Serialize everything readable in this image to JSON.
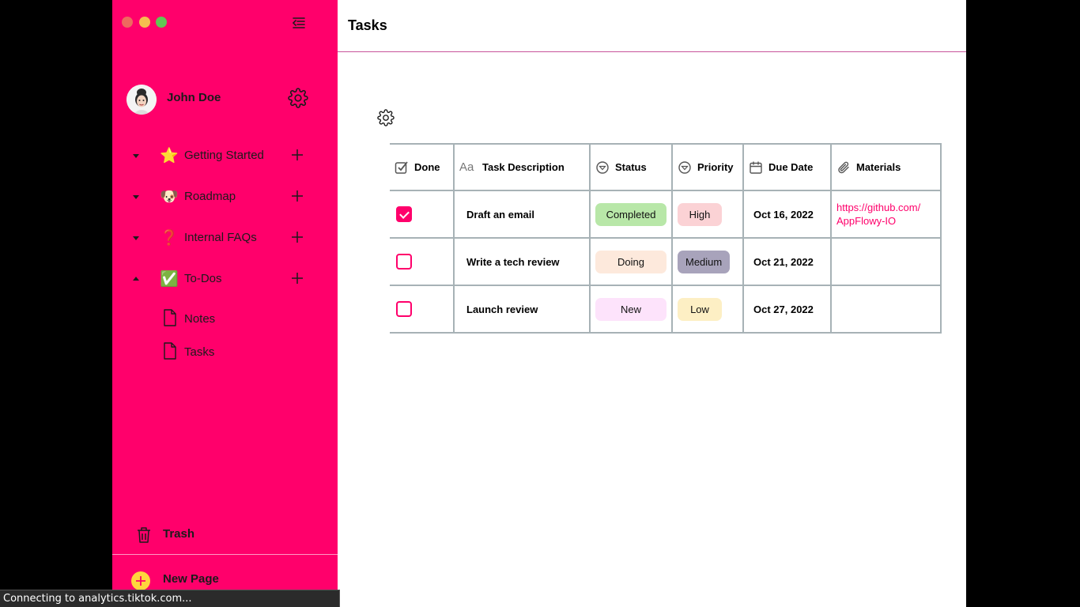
{
  "window": {
    "traffic_lights": [
      "#ee6a5f",
      "#f5bd4f",
      "#61c554"
    ]
  },
  "sidebar": {
    "bg_color": "#ff006b",
    "user": {
      "name": "John Doe"
    },
    "items": [
      {
        "label": "Getting Started",
        "emoji": "⭐",
        "expanded": false
      },
      {
        "label": "Roadmap",
        "emoji": "🐶",
        "expanded": false
      },
      {
        "label": "Internal FAQs",
        "emoji": "❓",
        "expanded": false
      },
      {
        "label": "To-Dos",
        "emoji": "✅",
        "expanded": true
      }
    ],
    "sub_items": [
      {
        "label": "Notes"
      },
      {
        "label": "Tasks"
      }
    ],
    "trash_label": "Trash",
    "new_page_label": "New Page"
  },
  "main": {
    "title": "Tasks",
    "grid": {
      "columns": [
        "Done",
        "Task Description",
        "Status",
        "Priority",
        "Due Date",
        "Materials"
      ],
      "rows": [
        {
          "done": true,
          "description": "Draft an email",
          "status": "Completed",
          "priority": "High",
          "due": "Oct 16, 2022",
          "material_line1": "https://github.com/",
          "material_line2": "AppFlowy-IO"
        },
        {
          "done": false,
          "description": "Write a tech review",
          "status": "Doing",
          "priority": "Medium",
          "due": "Oct 21, 2022",
          "material_line1": "",
          "material_line2": ""
        },
        {
          "done": false,
          "description": "Launch review",
          "status": "New",
          "priority": "Low",
          "due": "Oct 27, 2022",
          "material_line1": "",
          "material_line2": ""
        }
      ],
      "status_colors": {
        "Completed": "#b8e7a8",
        "Doing": "#fde9dc",
        "New": "#fde3fb"
      },
      "priority_colors": {
        "High": "#fbd2d5",
        "Medium": "#a8a3bb",
        "Low": "#fdefc4"
      }
    }
  },
  "statusbar": {
    "text": "Connecting to analytics.tiktok.com..."
  }
}
